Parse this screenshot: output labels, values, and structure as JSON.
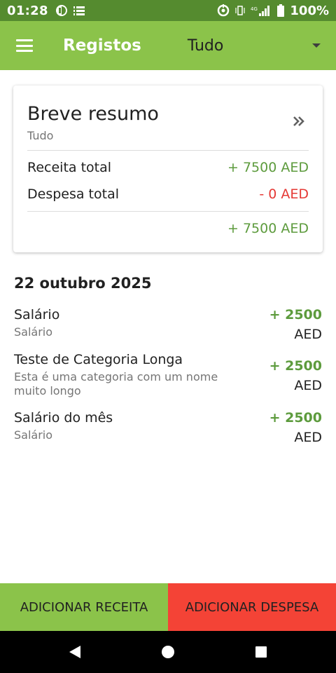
{
  "status_bar": {
    "time": "01:28",
    "battery": "100%",
    "icons": [
      "app-indicator-icon",
      "notes-icon",
      "sync-icon",
      "vibrate-icon",
      "lte-signal-icon",
      "battery-icon"
    ]
  },
  "toolbar": {
    "title": "Registos",
    "filter_value": "Tudo",
    "menu_icon": "hamburger-menu-icon",
    "dropdown_icon": "dropdown-arrow-icon"
  },
  "summary": {
    "title": "Breve resumo",
    "subtitle": "Tudo",
    "expand_icon": "double-chevron-right-icon",
    "income_label": "Receita total",
    "income_value": "+ 7500 AED",
    "expense_label": "Despesa total",
    "expense_value": "- 0 AED",
    "balance_value": "+ 7500 AED"
  },
  "records": {
    "date": "22 outubro 2025",
    "items": [
      {
        "title": "Salário",
        "category": "Salário",
        "amount": "+ 2500",
        "currency": "AED"
      },
      {
        "title": "Teste de Categoria Longa",
        "category": "Esta é uma categoria com um nome muito longo",
        "amount": "+ 2500",
        "currency": "AED"
      },
      {
        "title": "Salário do mês",
        "category": "Salário",
        "amount": "+ 2500",
        "currency": "AED"
      }
    ]
  },
  "actions": {
    "add_income": "ADICIONAR RECEITA",
    "add_expense": "ADICIONAR DESPESA"
  },
  "colors": {
    "status_bar": "#558b2f",
    "toolbar": "#8bc34a",
    "income": "#5d9b3d",
    "expense": "#e53935",
    "income_button": "#8bc34a",
    "expense_button": "#f44336"
  },
  "navigation": {
    "back_icon": "back-triangle-icon",
    "home_icon": "home-circle-icon",
    "recents_icon": "recents-square-icon"
  }
}
